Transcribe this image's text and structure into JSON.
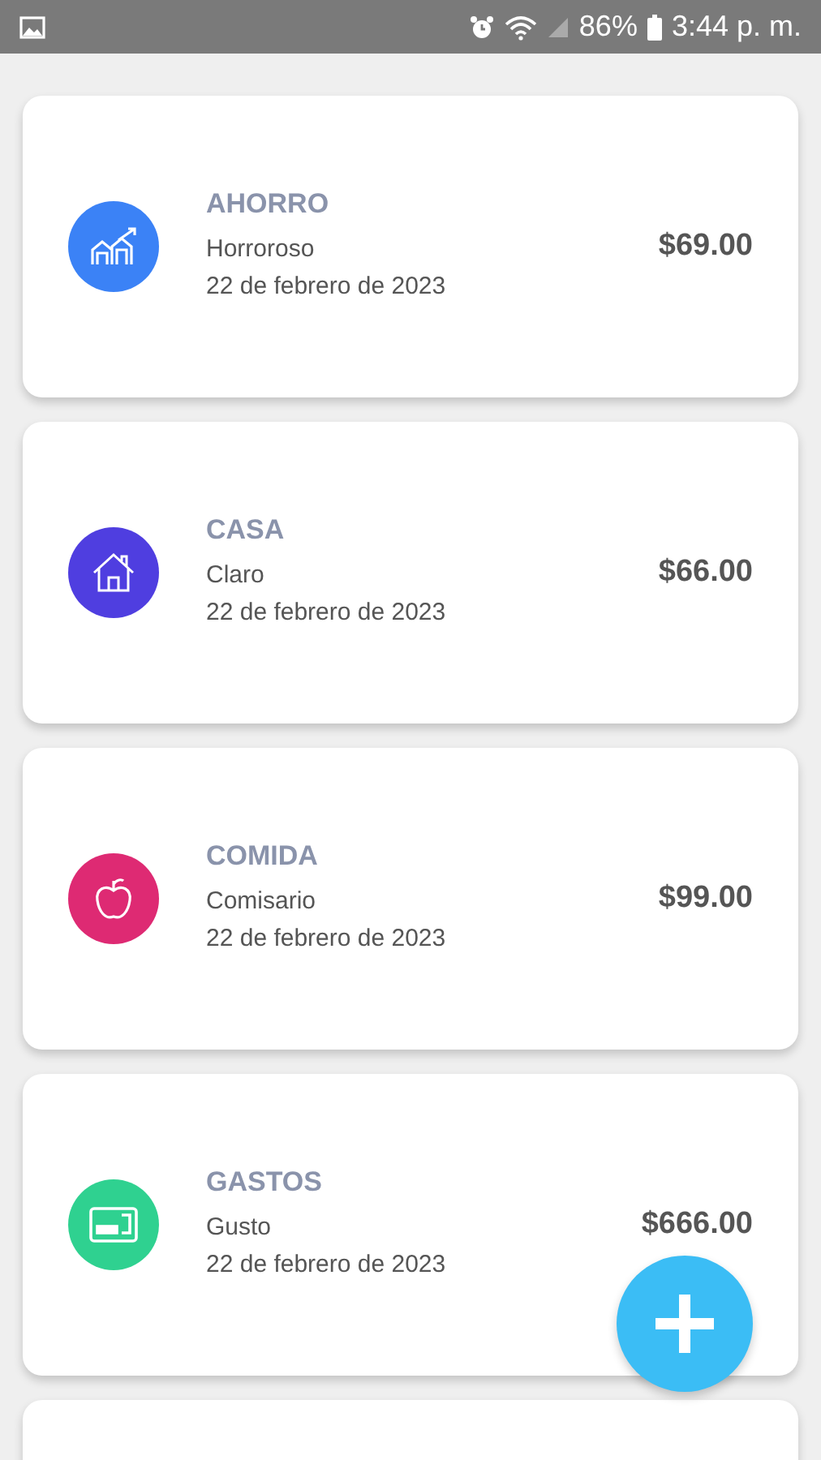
{
  "status_bar": {
    "battery": "86%",
    "time": "3:44 p. m."
  },
  "entries": [
    {
      "category": "AHORRO",
      "note": "Horroroso",
      "date": "22 de febrero de 2023",
      "amount": "$69.00",
      "kind": "chart",
      "color": "#3b82f6"
    },
    {
      "category": "CASA",
      "note": "Claro",
      "date": "22 de febrero de 2023",
      "amount": "$66.00",
      "kind": "house",
      "color": "#4f3ee0"
    },
    {
      "category": "COMIDA",
      "note": "Comisario",
      "date": "22 de febrero de 2023",
      "amount": "$99.00",
      "kind": "apple",
      "color": "#de2a73"
    },
    {
      "category": "GASTOS",
      "note": "Gusto",
      "date": "22 de febrero de 2023",
      "amount": "$666.00",
      "kind": "card",
      "color": "#2fd190"
    }
  ],
  "more_below": true
}
